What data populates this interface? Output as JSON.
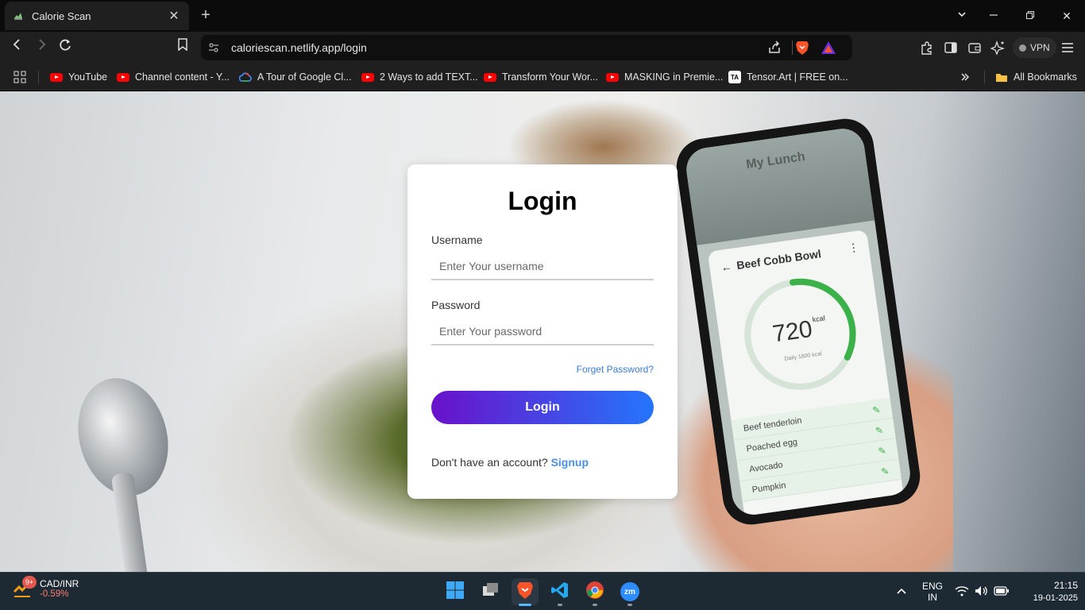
{
  "browser": {
    "tab_title": "Calorie Scan",
    "url": "caloriescan.netlify.app/login",
    "vpn_label": "VPN",
    "bookmarks": [
      {
        "label": "YouTube",
        "icon": "youtube-icon"
      },
      {
        "label": "Channel content - Y...",
        "icon": "youtube-icon"
      },
      {
        "label": "A Tour of Google Cl...",
        "icon": "google-cloud-icon"
      },
      {
        "label": "2 Ways to add TEXT...",
        "icon": "youtube-icon"
      },
      {
        "label": "Transform Your Wor...",
        "icon": "youtube-icon"
      },
      {
        "label": "MASKING in Premie...",
        "icon": "youtube-icon"
      },
      {
        "label": "Tensor.Art | FREE on...",
        "icon": "tensorart-icon"
      }
    ],
    "all_bookmarks_label": "All Bookmarks"
  },
  "login": {
    "title": "Login",
    "username_label": "Username",
    "username_placeholder": "Enter Your username",
    "password_label": "Password",
    "password_placeholder": "Enter Your password",
    "forgot_link": "Forget Password?",
    "login_button": "Login",
    "signup_prompt": "Don't have an account?",
    "signup_link": "Signup"
  },
  "phone_app": {
    "header_title": "My Lunch",
    "dish": "Beef Cobb Bowl",
    "calories": "720",
    "calories_unit": "kcal",
    "daily_label": "Daily 1800 kcal",
    "ingredients": [
      "Beef tenderloin",
      "Poached egg",
      "Avocado",
      "Pumpkin"
    ]
  },
  "taskbar": {
    "weather_badge": "9+",
    "ticker": "CAD/INR",
    "ticker_change": "-0.59%",
    "lang_line1": "ENG",
    "lang_line2": "IN",
    "time": "21:15",
    "date": "19-01-2025"
  },
  "colors": {
    "login_gradient_start": "#6a11cb",
    "login_gradient_end": "#2575fc",
    "link_blue": "#4a90e2",
    "calorie_green": "#3bb14a"
  }
}
